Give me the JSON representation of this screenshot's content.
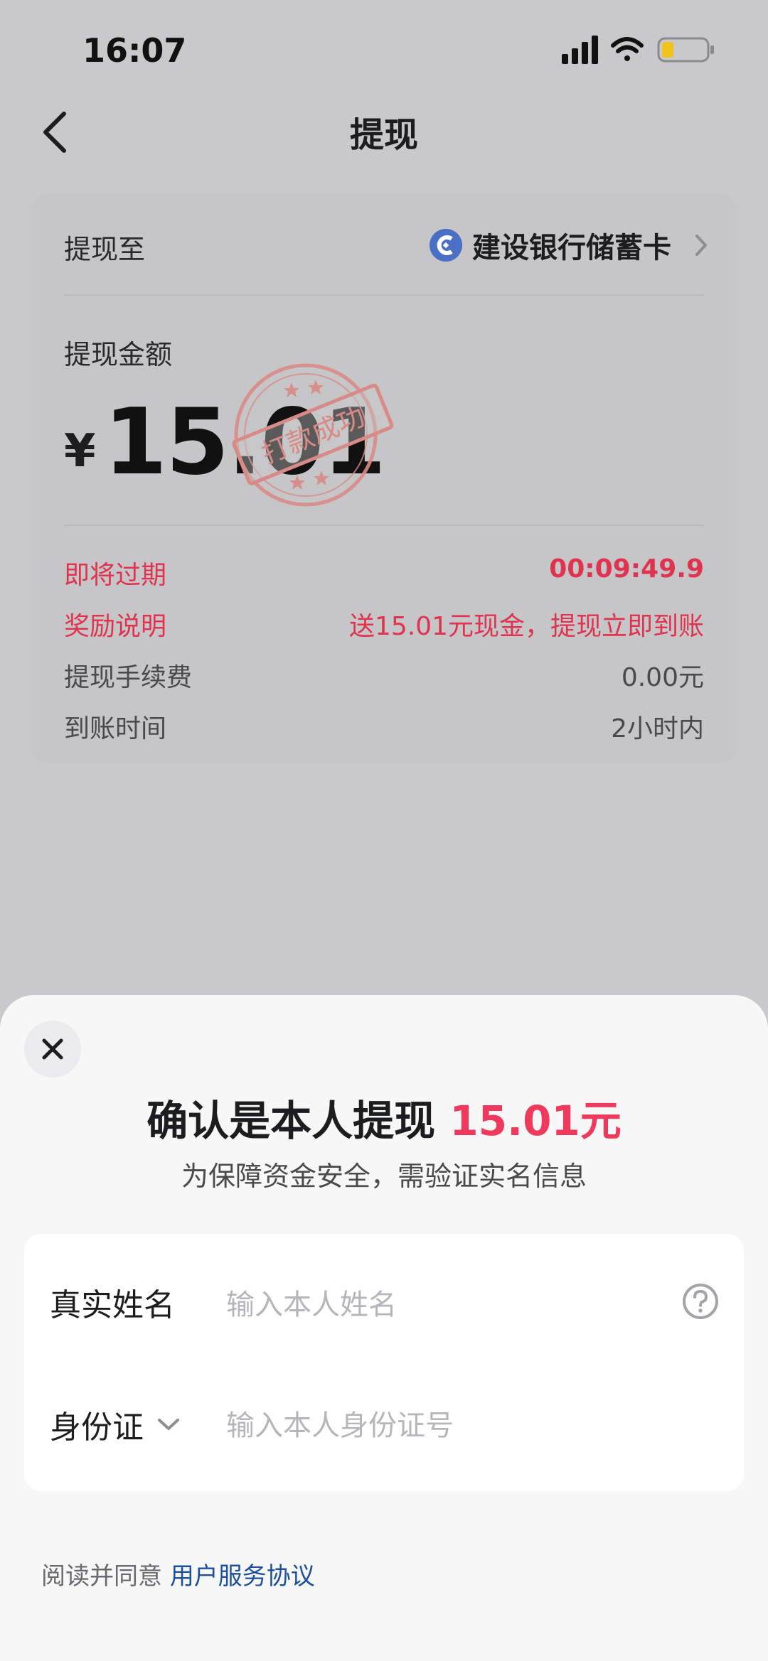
{
  "status_bar": {
    "time": "16:07"
  },
  "header": {
    "title": "提现"
  },
  "card": {
    "to_label": "提现至",
    "bank_name": "建设银行储蓄卡",
    "amount_label": "提现金额",
    "currency_symbol": "¥",
    "amount": "15.01",
    "stamp_text": "打款成功",
    "rows": [
      {
        "label": "即将过期",
        "value": "00:09:49.9"
      },
      {
        "label": "奖励说明",
        "value": "送15.01元现金，提现立即到账"
      },
      {
        "label": "提现手续费",
        "value": "0.00元"
      },
      {
        "label": "到账时间",
        "value": "2小时内"
      }
    ]
  },
  "sheet": {
    "title_prefix": "确认是本人提现 ",
    "title_amount": "15.01元",
    "subtitle": "为保障资金安全，需验证实名信息",
    "name_label": "真实姓名",
    "name_placeholder": "输入本人姓名",
    "id_label": "身份证",
    "id_placeholder": "输入本人身份证号",
    "agree_prefix": "阅读并同意 ",
    "agree_link": "用户服务协议"
  },
  "colors": {
    "accent_red": "#e0334f",
    "amount_pink": "#ef3a5d",
    "link_blue": "#1e4f9c",
    "bank_blue": "#4a6fc4"
  }
}
